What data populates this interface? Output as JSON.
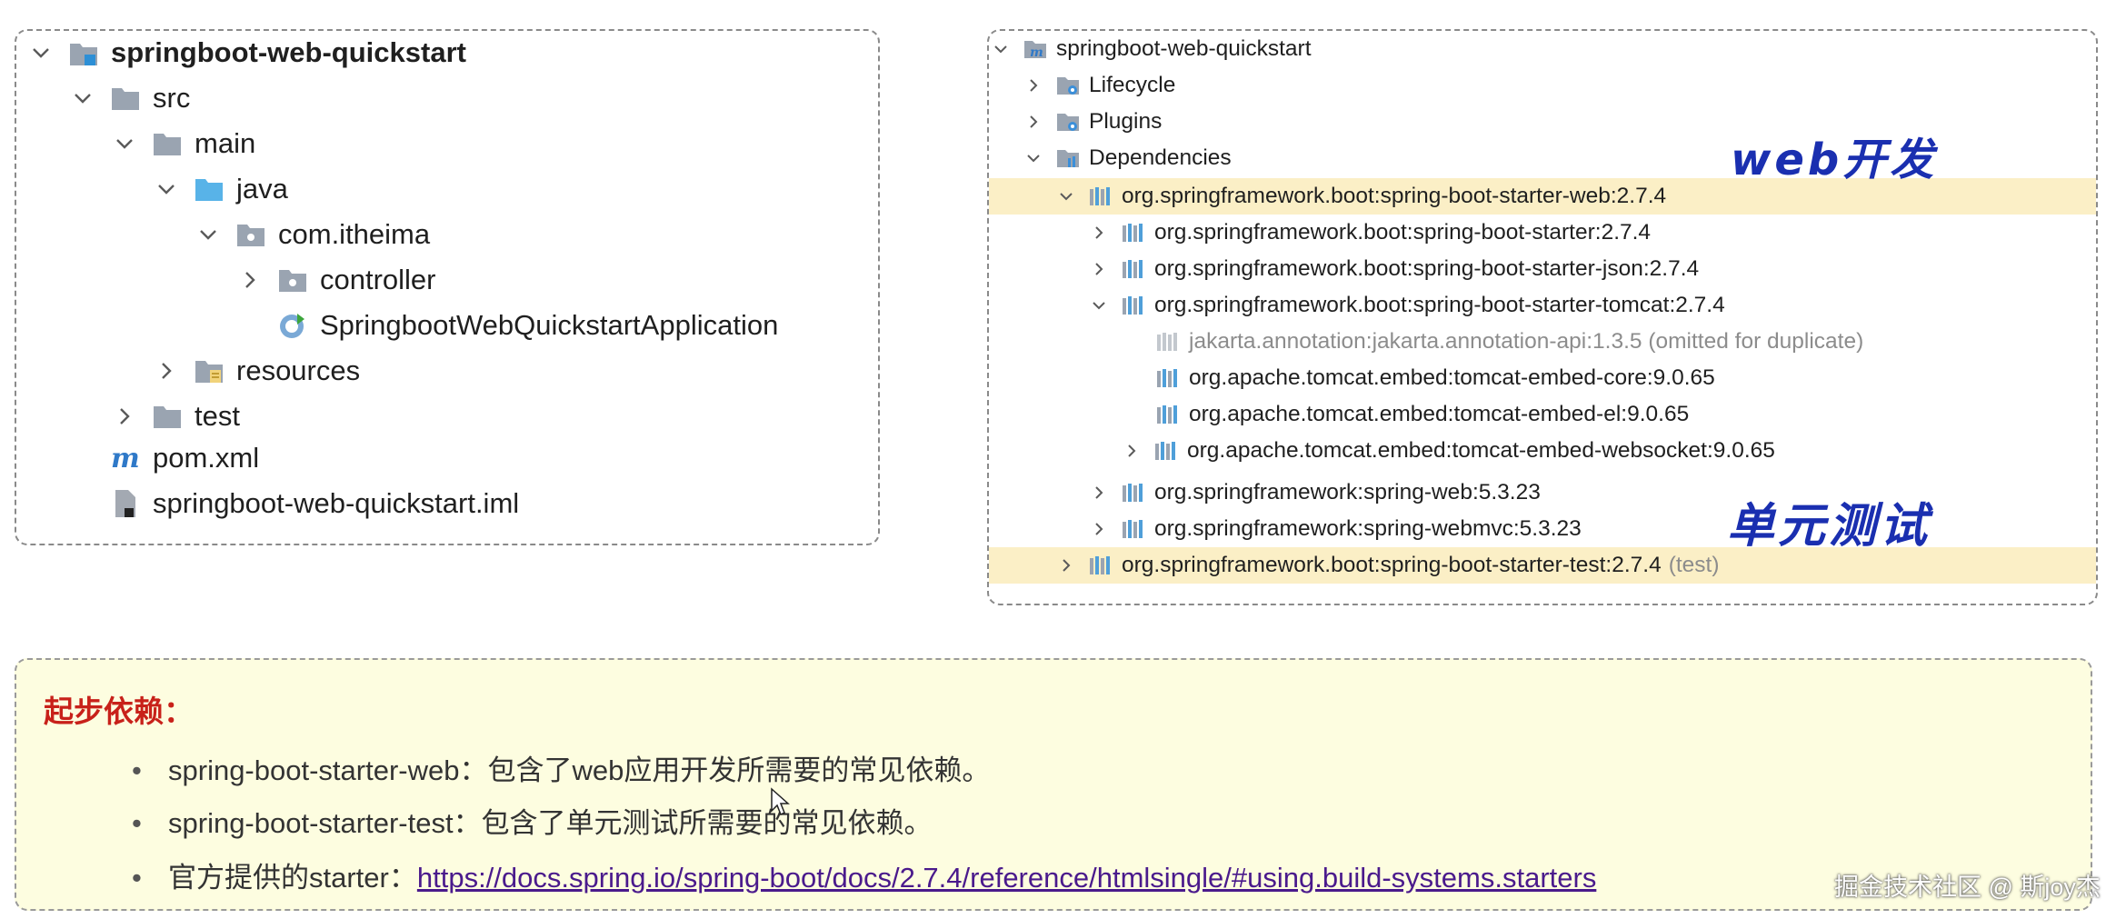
{
  "left_tree": {
    "items": [
      {
        "label": "springboot-web-quickstart"
      },
      {
        "label": "src"
      },
      {
        "label": "main"
      },
      {
        "label": "java"
      },
      {
        "label": "com.itheima"
      },
      {
        "label": "controller"
      },
      {
        "label": "SpringbootWebQuickstartApplication"
      },
      {
        "label": "resources"
      },
      {
        "label": "test"
      },
      {
        "label": "pom.xml"
      },
      {
        "label": "springboot-web-quickstart.iml"
      }
    ]
  },
  "right_tree": {
    "items": [
      {
        "label": "springboot-web-quickstart"
      },
      {
        "label": "Lifecycle"
      },
      {
        "label": "Plugins"
      },
      {
        "label": "Dependencies"
      },
      {
        "label": "org.springframework.boot:spring-boot-starter-web:2.7.4"
      },
      {
        "label": "org.springframework.boot:spring-boot-starter:2.7.4"
      },
      {
        "label": "org.springframework.boot:spring-boot-starter-json:2.7.4"
      },
      {
        "label": "org.springframework.boot:spring-boot-starter-tomcat:2.7.4"
      },
      {
        "label": "jakarta.annotation:jakarta.annotation-api:1.3.5 (omitted for duplicate)"
      },
      {
        "label": "org.apache.tomcat.embed:tomcat-embed-core:9.0.65"
      },
      {
        "label": "org.apache.tomcat.embed:tomcat-embed-el:9.0.65"
      },
      {
        "label": "org.apache.tomcat.embed:tomcat-embed-websocket:9.0.65"
      },
      {
        "label": "org.springframework:spring-web:5.3.23"
      },
      {
        "label": "org.springframework:spring-webmvc:5.3.23"
      },
      {
        "label": "org.springframework.boot:spring-boot-starter-test:2.7.4",
        "suffix": "(test)"
      }
    ]
  },
  "annotations": {
    "web_dev": "web开发",
    "unit_test": "单元测试"
  },
  "note": {
    "title": "起步依赖：",
    "bullets": [
      "spring-boot-starter-web：包含了web应用开发所需要的常见依赖。",
      "spring-boot-starter-test：包含了单元测试所需要的常见依赖。"
    ],
    "official_prefix": "官方提供的starter：",
    "official_link": "https://docs.spring.io/spring-boot/docs/2.7.4/reference/htmlsingle/#using.build-systems.starters"
  },
  "watermark": "掘金技术社区 @ 斯joy杰",
  "colors": {
    "highlight_row": "#fbefc6",
    "note_background": "#fdfde0",
    "note_title": "#c8211a",
    "handwriting": "#1a2fb0",
    "link": "#4a1a8c"
  }
}
